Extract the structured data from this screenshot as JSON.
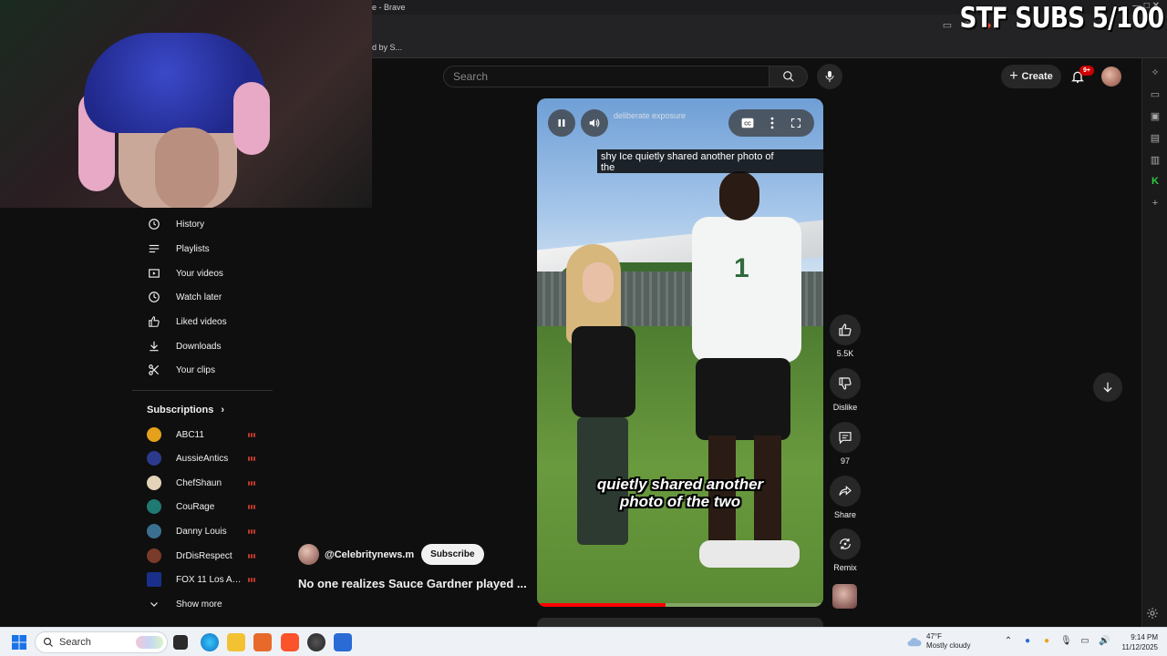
{
  "browser": {
    "title": "e - Brave",
    "bookmark": "d by S...",
    "window_controls": "— □ ✕"
  },
  "overlay": {
    "sub_goal": "STF SUBS 5/100"
  },
  "header": {
    "search_placeholder": "Search",
    "create_label": "Create",
    "notifications": "9+"
  },
  "guide": {
    "items": [
      {
        "label": "History",
        "icon": "history-icon"
      },
      {
        "label": "Playlists",
        "icon": "playlists-icon"
      },
      {
        "label": "Your videos",
        "icon": "your-videos-icon"
      },
      {
        "label": "Watch later",
        "icon": "watch-later-icon"
      },
      {
        "label": "Liked videos",
        "icon": "thumbs-up-icon"
      },
      {
        "label": "Downloads",
        "icon": "download-icon"
      },
      {
        "label": "Your clips",
        "icon": "scissors-icon"
      }
    ],
    "subscriptions_title": "Subscriptions",
    "subscriptions": [
      {
        "label": "ABC11",
        "color": "#e4a11b"
      },
      {
        "label": "AussieAntics",
        "color": "#2b3a8c"
      },
      {
        "label": "ChefShaun",
        "color": "#e3d3b8"
      },
      {
        "label": "CouRage",
        "color": "#1f7a73"
      },
      {
        "label": "Danny Louis",
        "color": "#3a6f8f"
      },
      {
        "label": "DrDisRespect",
        "color": "#7a3a2a"
      },
      {
        "label": "FOX 11 Los Ang...",
        "color": "#1a2f8a"
      }
    ],
    "show_more": "Show more"
  },
  "short": {
    "overlay_title": "deliberate exposure",
    "caption_line1": "shy Ice quietly shared another photo of",
    "caption_line2": "the",
    "burned_line1": "quietly shared another",
    "burned_line2": "photo of the two",
    "progress": 0.45,
    "channel": "@Celebritynews.m",
    "subscribe": "Subscribe",
    "title": "No one realizes Sauce Gardner played ..."
  },
  "actions": {
    "like_count": "5.5K",
    "dislike": "Dislike",
    "comments": "97",
    "share": "Share",
    "remix": "Remix"
  },
  "taskbar": {
    "search": "Search",
    "temp": "47°F",
    "weather": "Mostly cloudy",
    "time": "9:14 PM",
    "date": "11/12/2025"
  }
}
